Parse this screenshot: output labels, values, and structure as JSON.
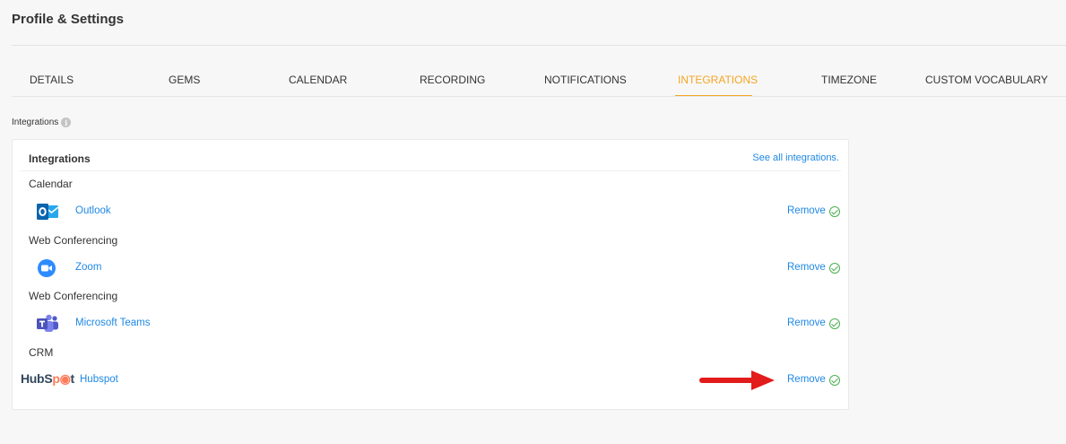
{
  "page": {
    "title": "Profile & Settings"
  },
  "tabs": [
    {
      "label": "DETAILS",
      "active": false
    },
    {
      "label": "GEMS",
      "active": false
    },
    {
      "label": "CALENDAR",
      "active": false
    },
    {
      "label": "RECORDING",
      "active": false
    },
    {
      "label": "NOTIFICATIONS",
      "active": false
    },
    {
      "label": "INTEGRATIONS",
      "active": true
    },
    {
      "label": "TIMEZONE",
      "active": false
    },
    {
      "label": "CUSTOM VOCABULARY",
      "active": false
    }
  ],
  "section": {
    "label": "Integrations",
    "info_icon": "i"
  },
  "card": {
    "header": "Integrations",
    "see_all": "See all integrations.",
    "groups": [
      {
        "category": "Calendar",
        "name": "Outlook",
        "remove": "Remove",
        "icon": "outlook-icon"
      },
      {
        "category": "Web Conferencing",
        "name": "Zoom",
        "remove": "Remove",
        "icon": "zoom-icon"
      },
      {
        "category": "Web Conferencing",
        "name": "Microsoft Teams",
        "remove": "Remove",
        "icon": "teams-icon"
      },
      {
        "category": "CRM",
        "name": "Hubspot",
        "remove": "Remove",
        "icon": "hubspot-logo",
        "logo_text_a": "HubS",
        "logo_text_b": "p",
        "logo_text_c": "t"
      }
    ]
  },
  "colors": {
    "accent": "#f5a623",
    "link": "#1e88e5",
    "success": "#4caf50",
    "arrow": "#e21b1b"
  }
}
